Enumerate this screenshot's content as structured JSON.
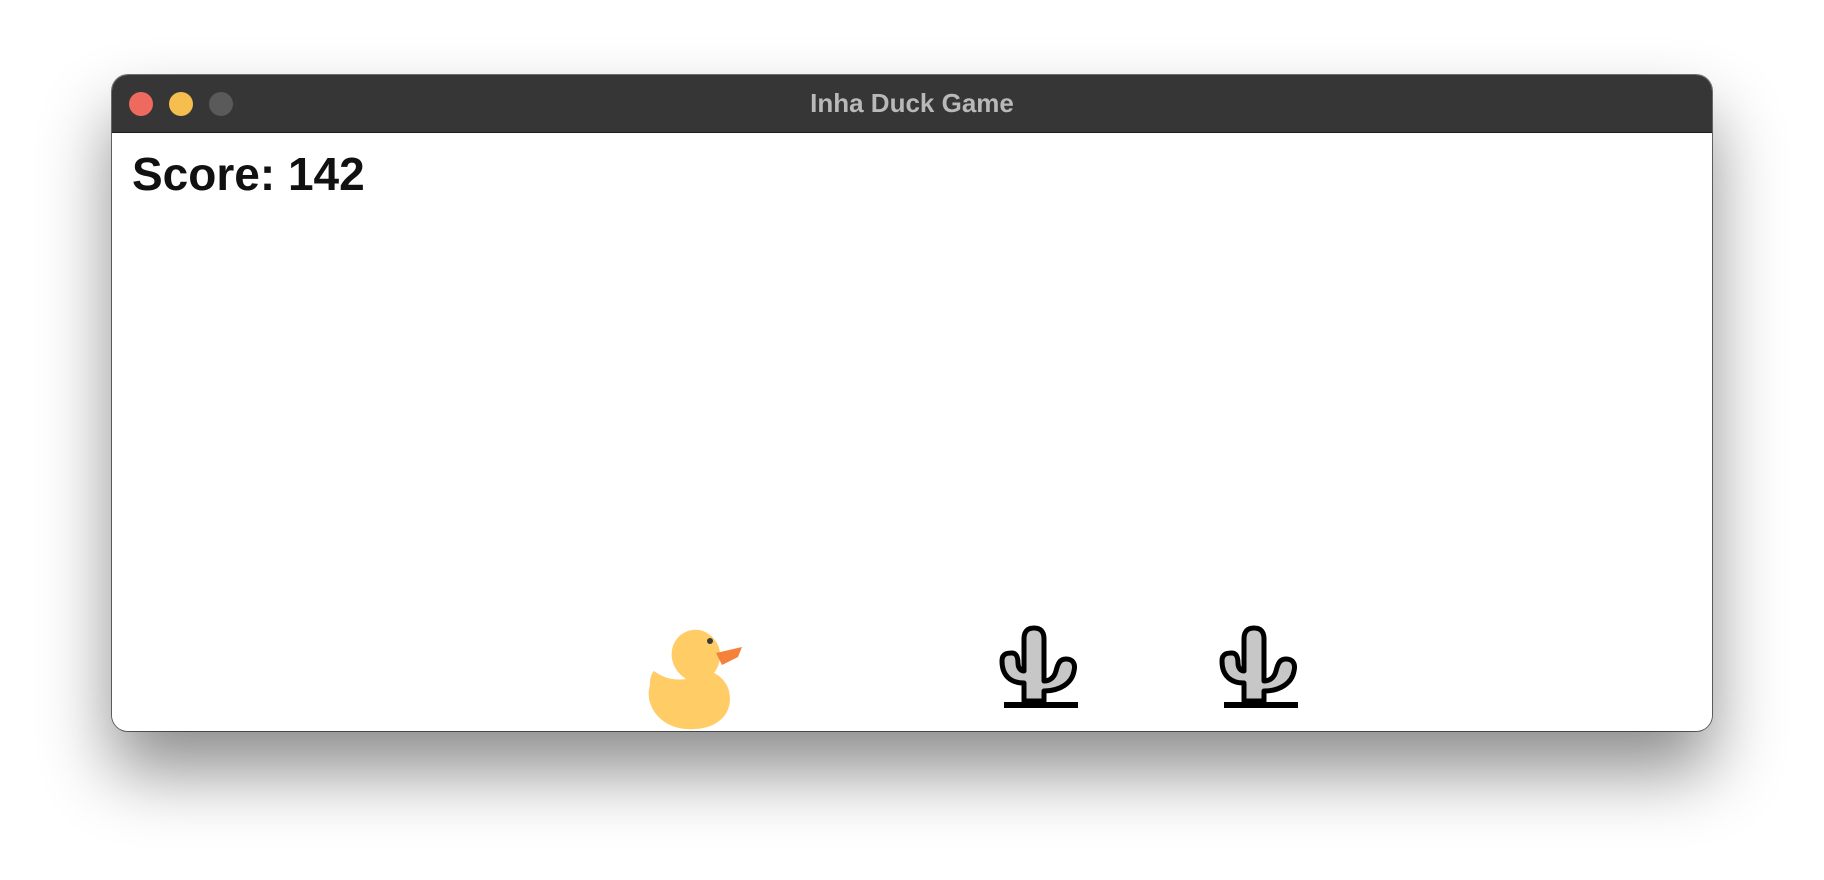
{
  "window": {
    "title": "Inha Duck Game"
  },
  "game": {
    "score_text": "Score: 142"
  },
  "icons": {
    "player": "duck-icon",
    "obstacle": "cactus-icon"
  },
  "colors": {
    "close": "#ee6a5f",
    "minimize": "#f5be4f",
    "zoom": "#5a5a5a",
    "titlebar": "#363636",
    "duck_body": "#ffcc66",
    "duck_beak": "#f5823a",
    "cactus_fill": "#c7c7c7",
    "cactus_outline": "#000000"
  }
}
